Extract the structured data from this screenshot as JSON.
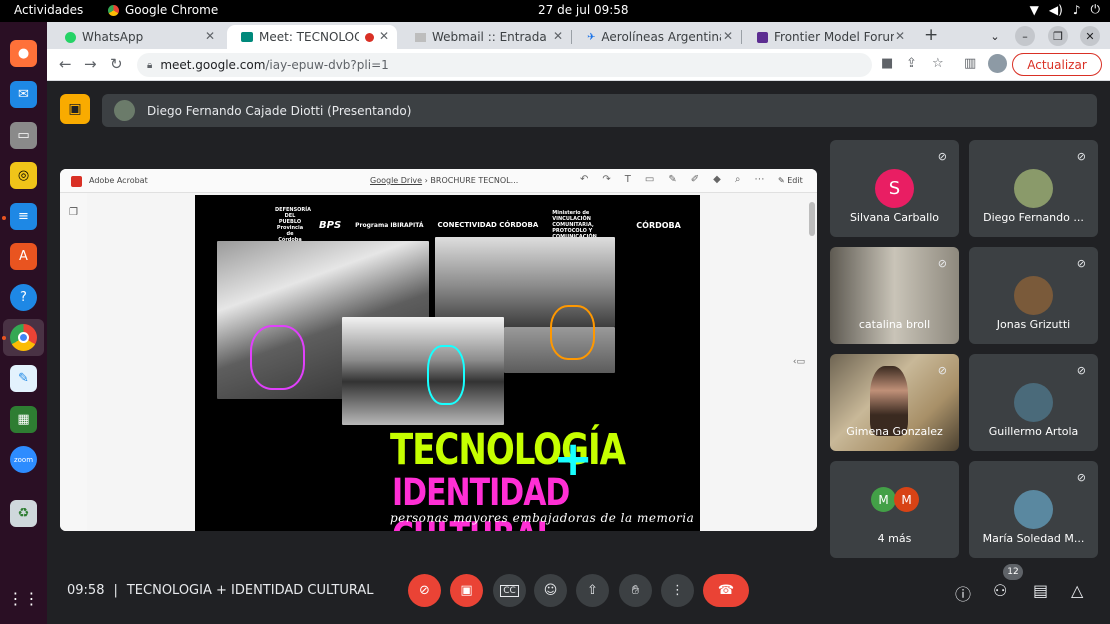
{
  "system": {
    "activities": "Actividades",
    "app_name": "Google Chrome",
    "date_time": "27 de jul  09:58"
  },
  "dock": {
    "icons": [
      "firefox-icon",
      "thunderbird-icon",
      "files-icon",
      "rhythmbox-icon",
      "writer-icon",
      "software-icon",
      "help-icon",
      "chrome-icon",
      "text-editor-icon",
      "calc-icon",
      "zoom-icon",
      "trash-icon",
      "apps-grid-icon"
    ],
    "zoom_label": "zoom"
  },
  "browser": {
    "tabs": [
      {
        "label": "WhatsApp",
        "icon": "whatsapp-icon",
        "color": "#25d366"
      },
      {
        "label": "Meet: TECNOLOGÍ",
        "icon": "meet-icon",
        "color": "#00897b"
      },
      {
        "label": "Webmail :: Entrada",
        "icon": "mail-icon",
        "color": "#9aa0a6"
      },
      {
        "label": "Aerolíneas Argentinas",
        "icon": "plane-icon",
        "color": "#1a73e8"
      },
      {
        "label": "Frontier Model Forum",
        "icon": "frontier-icon",
        "color": "#5c2d91"
      }
    ],
    "url_host": "meet.google.com",
    "url_path": "/iay-epuw-dvb?pli=1",
    "update_label": "Actualizar"
  },
  "meet": {
    "presenter": "Diego Fernando Cajade Diotti (Presentando)",
    "share": {
      "app": "Adobe Acrobat",
      "crumb_drive": "Google Drive",
      "crumb_sep": "›",
      "crumb_doc": "BROCHURE TECNOL...",
      "edit_label": "Edit",
      "logos": [
        "DEFENSORÍA DEL PUEBLO Provincia de Córdoba",
        "BPS",
        "Programa IBIRAPITÁ",
        "CONECTIVIDAD CÓRDOBA",
        "Ministerio de VINCULACIÓN COMUNITARIA, PROTOCOLO Y COMUNICACIÓN",
        "CÓRDOBA"
      ],
      "title_line1": "TECNOLOGÍA",
      "plus": "+",
      "title_line2": "IDENTIDAD CULTURAL",
      "subtitle": "personas mayores embajadoras de la memoria"
    },
    "participants": [
      {
        "name": "Silvana Carballo",
        "initial": "S",
        "avatar_color": "#e91e63",
        "muted": true
      },
      {
        "name": "Diego Fernando ...",
        "muted": true
      },
      {
        "name": "catalina broll",
        "muted": true
      },
      {
        "name": "Jonas Grizutti",
        "muted": true
      },
      {
        "name": "Gimena Gonzalez",
        "muted": true
      },
      {
        "name": "Guillermo Artola",
        "muted": true
      },
      {
        "name": "4 más",
        "initials": [
          "M",
          "M"
        ],
        "colors": [
          "#43a047",
          "#d84315"
        ]
      },
      {
        "name": "María Soledad M...",
        "muted": true
      }
    ],
    "meeting_time": "09:58",
    "meeting_sep": "|",
    "meeting_title": "TECNOLOGIA + IDENTIDAD CULTURAL",
    "participant_count": "12",
    "colors": {
      "accent_red": "#ea4335",
      "present_yellow": "#f9ab00"
    }
  }
}
